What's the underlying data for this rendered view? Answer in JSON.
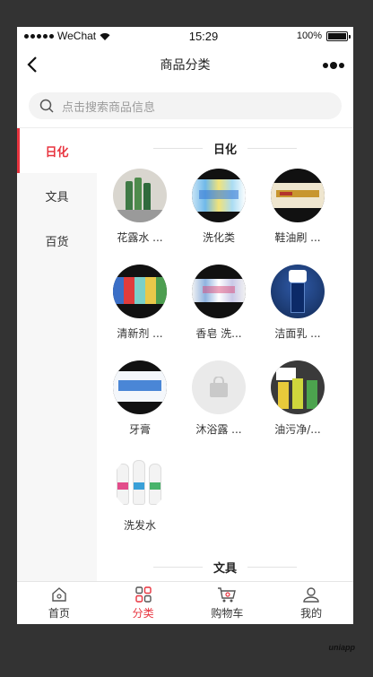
{
  "status_bar": {
    "carrier": "WeChat",
    "time": "15:29",
    "battery": "100%"
  },
  "navbar": {
    "title": "商品分类"
  },
  "search": {
    "placeholder": "点击搜索商品信息"
  },
  "sidebar": {
    "items": [
      {
        "label": "日化",
        "active": true
      },
      {
        "label": "文具",
        "active": false
      },
      {
        "label": "百货",
        "active": false
      }
    ]
  },
  "sections": [
    {
      "title": "日化",
      "items": [
        {
          "label": "花露水 ...",
          "icon": "floral-water-bottles"
        },
        {
          "label": "洗化类",
          "icon": "toiletries"
        },
        {
          "label": "鞋油刷 ...",
          "icon": "shoe-polish-brush"
        },
        {
          "label": "清新剂 ...",
          "icon": "air-freshener"
        },
        {
          "label": "香皂 洗...",
          "icon": "soap"
        },
        {
          "label": "洁面乳 ...",
          "icon": "facial-cleanser"
        },
        {
          "label": "牙膏",
          "icon": "toothpaste"
        },
        {
          "label": "沐浴露 ...",
          "icon": "shopping-bag-placeholder"
        },
        {
          "label": "油污净/...",
          "icon": "degreaser"
        },
        {
          "label": "洗发水",
          "icon": "shampoo"
        }
      ]
    },
    {
      "title": "文具",
      "items": []
    }
  ],
  "tabbar": {
    "items": [
      {
        "label": "首页",
        "icon": "home-icon",
        "active": false
      },
      {
        "label": "分类",
        "icon": "category-grid-icon",
        "active": true
      },
      {
        "label": "购物车",
        "icon": "cart-icon",
        "active": false
      },
      {
        "label": "我的",
        "icon": "user-icon",
        "active": false
      }
    ]
  },
  "watermark": "uniapp",
  "colors": {
    "accent": "#e8343f",
    "background": "#333333"
  }
}
